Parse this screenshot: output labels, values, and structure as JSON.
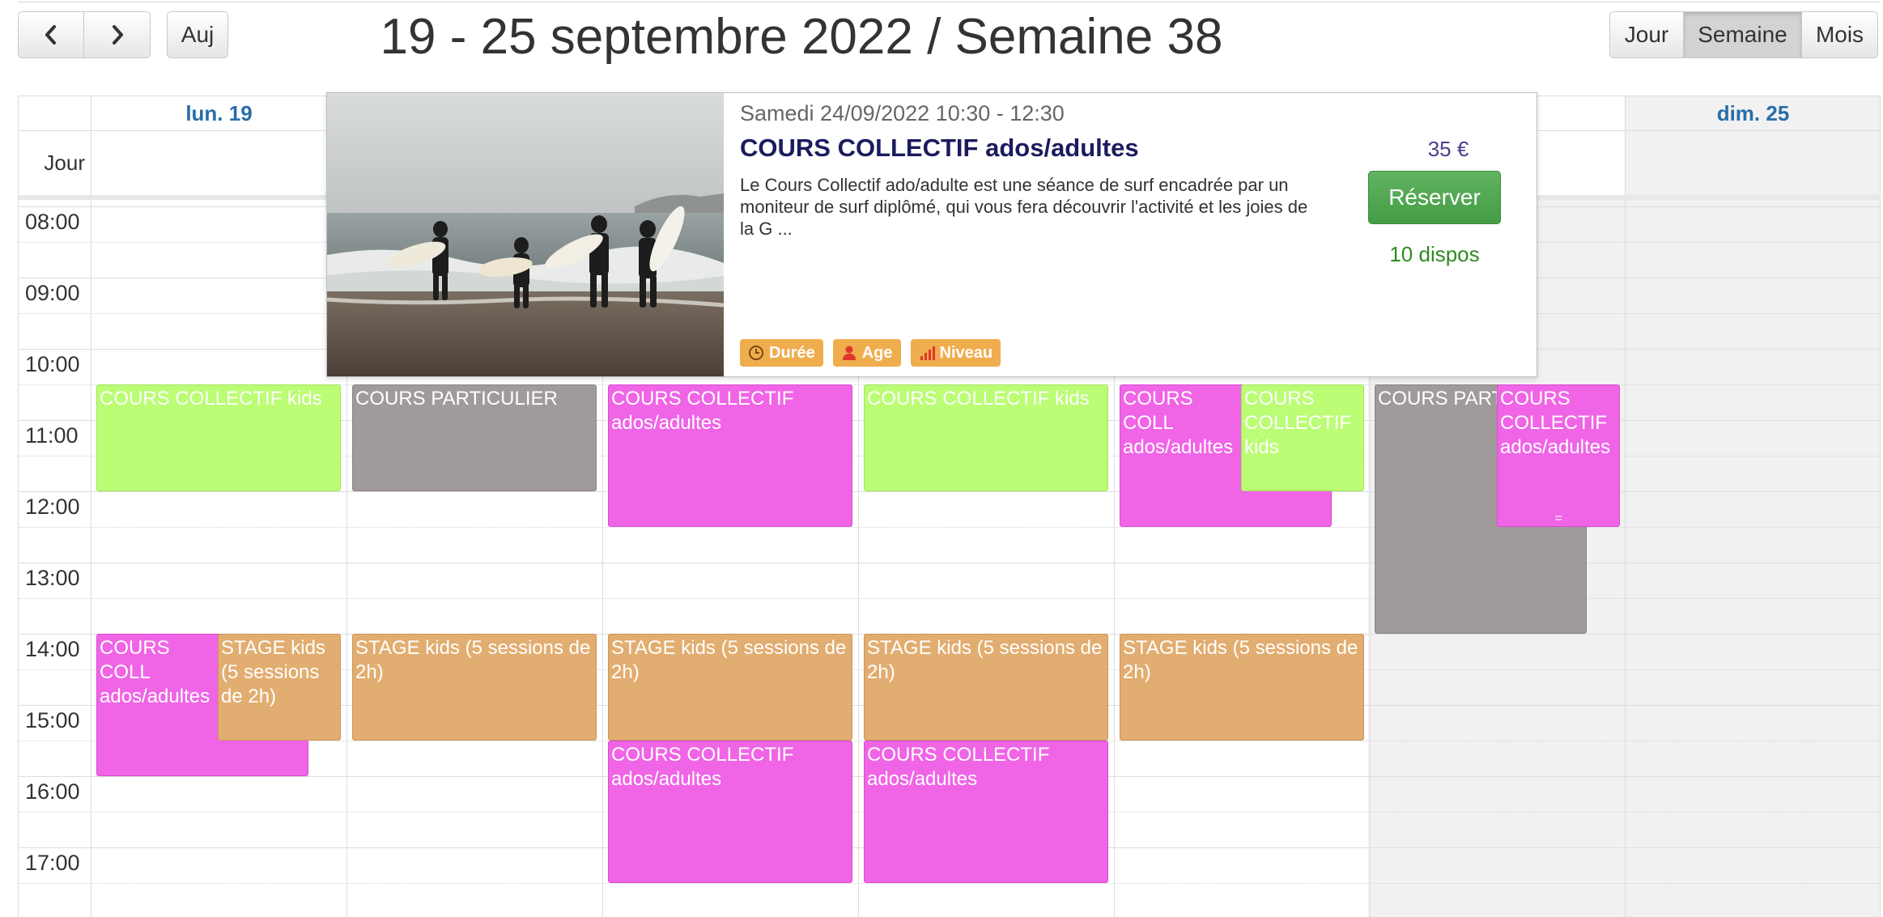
{
  "toolbar": {
    "prev_icon": "chevron-left-icon",
    "next_icon": "chevron-right-icon",
    "today_label": "Auj",
    "title": "19 - 25 septembre 2022 / Semaine 38",
    "views": [
      {
        "label": "Jour",
        "active": false
      },
      {
        "label": "Semaine",
        "active": true
      },
      {
        "label": "Mois",
        "active": false
      }
    ]
  },
  "calendar": {
    "allday_label": "Jour",
    "days": [
      "lun. 19",
      "",
      "",
      "",
      "",
      "",
      "dim. 25"
    ],
    "hours": [
      "08:00",
      "09:00",
      "10:00",
      "11:00",
      "12:00",
      "13:00",
      "14:00",
      "15:00",
      "16:00",
      "17:00"
    ],
    "events": [
      {
        "day": "lun. 19",
        "title": "COURS COLLECTIF kids",
        "category": "kids",
        "start": "10:30",
        "end": "12:00"
      },
      {
        "day": "mar. 20",
        "title": "COURS PARTICULIER",
        "category": "part",
        "start": "10:30",
        "end": "12:00"
      },
      {
        "day": "mer. 21",
        "title": "COURS COLLECTIF ados/adultes",
        "category": "adultes",
        "start": "10:30",
        "end": "12:30"
      },
      {
        "day": "jeu. 22",
        "title": "COURS COLLECTIF kids",
        "category": "kids",
        "start": "10:30",
        "end": "12:00"
      },
      {
        "day": "ven. 23",
        "title": "COURS COLLECTIF ados/adultes",
        "display_title": "COURS COLL ados/adultes",
        "category": "adultes",
        "start": "10:30",
        "end": "12:30"
      },
      {
        "day": "ven. 23",
        "title": "COURS COLLECTIF kids",
        "category": "kids",
        "start": "10:30",
        "end": "12:00"
      },
      {
        "day": "sam. 24",
        "title": "COURS PARTICULIER",
        "display_title": "COURS PART",
        "category": "part",
        "start": "10:30",
        "end": "14:00"
      },
      {
        "day": "sam. 24",
        "title": "COURS COLLECTIF ados/adultes",
        "category": "adultes",
        "start": "10:30",
        "end": "12:30",
        "handle": "="
      },
      {
        "day": "lun. 19",
        "title": "COURS COLLECTIF ados/adultes",
        "display_title": "COURS COLL ados/adultes",
        "category": "adultes",
        "start": "14:00",
        "end": "15:45"
      },
      {
        "day": "lun. 19",
        "title": "STAGE kids (5 sessions de 2h)",
        "category": "stage",
        "start": "14:00",
        "end": "15:30"
      },
      {
        "day": "mar. 20",
        "title": "STAGE kids (5 sessions de 2h)",
        "category": "stage",
        "start": "14:00",
        "end": "15:30"
      },
      {
        "day": "mer. 21",
        "title": "STAGE kids (5 sessions de 2h)",
        "category": "stage",
        "start": "14:00",
        "end": "15:30"
      },
      {
        "day": "jeu. 22",
        "title": "STAGE kids (5 sessions de 2h)",
        "category": "stage",
        "start": "14:00",
        "end": "15:30"
      },
      {
        "day": "ven. 23",
        "title": "STAGE kids (5 sessions de 2h)",
        "category": "stage",
        "start": "14:00",
        "end": "15:30"
      },
      {
        "day": "mer. 21",
        "title": "COURS COLLECTIF ados/adultes",
        "category": "adultes",
        "start": "15:30",
        "end": "17:30"
      },
      {
        "day": "jeu. 22",
        "title": "COURS COLLECTIF ados/adultes",
        "category": "adultes",
        "start": "15:30",
        "end": "17:30"
      }
    ]
  },
  "popup": {
    "datetime": "Samedi 24/09/2022 10:30 - 12:30",
    "title": "COURS COLLECTIF ados/adultes",
    "description": "Le Cours Collectif ado/adulte est une séance de surf encadrée par un moniteur de surf diplômé, qui vous fera découvrir l'activité et les joies de la G ...",
    "price": "35 €",
    "reserve_label": "Réserver",
    "availability": "10 dispos",
    "tags": [
      {
        "label": "Durée",
        "icon": "clock-icon"
      },
      {
        "label": "Age",
        "icon": "person-icon"
      },
      {
        "label": "Niveau",
        "icon": "signal-bars-icon"
      }
    ]
  },
  "colors": {
    "kids": "#bbfd74",
    "adultes": "#ef65e6",
    "particulier": "#a09a9a",
    "stage": "#e2ad70",
    "reserve": "#449d44",
    "tag": "#f0ad4e",
    "day_header": "#2a6da8"
  }
}
